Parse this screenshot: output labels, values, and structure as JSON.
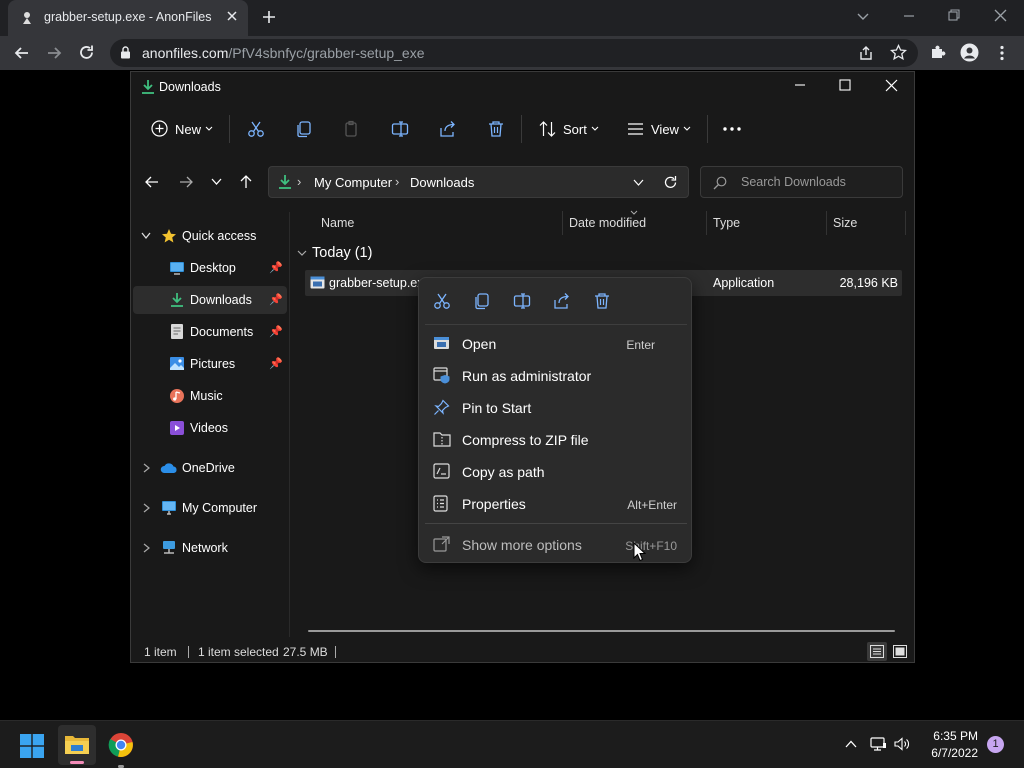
{
  "browser": {
    "tab_title": "grabber-setup.exe - AnonFiles",
    "url_host": "anonfiles.com",
    "url_path": "/PfV4sbnfyc/grabber-setup_exe"
  },
  "explorer": {
    "window_title": "Downloads",
    "toolbar": {
      "new_label": "New",
      "sort_label": "Sort",
      "view_label": "View",
      "more_label": "..."
    },
    "breadcrumb": [
      "My Computer",
      "Downloads"
    ],
    "search_placeholder": "Search Downloads",
    "nav": {
      "quick_access": "Quick access",
      "items": [
        {
          "label": "Desktop",
          "icon": "desktop-icon",
          "pinned": true
        },
        {
          "label": "Downloads",
          "icon": "downloads-icon",
          "pinned": true,
          "selected": true
        },
        {
          "label": "Documents",
          "icon": "documents-icon",
          "pinned": true
        },
        {
          "label": "Pictures",
          "icon": "pictures-icon",
          "pinned": true
        },
        {
          "label": "Music",
          "icon": "music-icon",
          "pinned": false
        },
        {
          "label": "Videos",
          "icon": "videos-icon",
          "pinned": false
        }
      ],
      "onedrive": "OneDrive",
      "my_computer": "My Computer",
      "network": "Network"
    },
    "columns": [
      "Name",
      "Date modified",
      "Type",
      "Size"
    ],
    "group_label": "Today (1)",
    "file": {
      "name": "grabber-setup.exe",
      "type": "Application",
      "size": "28,196 KB"
    },
    "status": {
      "items": "1 item",
      "selected": "1 item selected",
      "size": "27.5 MB"
    }
  },
  "context_menu": {
    "items": [
      {
        "label": "Open",
        "shortcut": "Enter",
        "icon": "open-icon"
      },
      {
        "label": "Run as administrator",
        "shortcut": "",
        "icon": "run-as-admin-icon"
      },
      {
        "label": "Pin to Start",
        "shortcut": "",
        "icon": "pin-icon"
      },
      {
        "label": "Compress to ZIP file",
        "shortcut": "",
        "icon": "zip-icon"
      },
      {
        "label": "Copy as path",
        "shortcut": "",
        "icon": "copy-path-icon"
      },
      {
        "label": "Properties",
        "shortcut": "Alt+Enter",
        "icon": "properties-icon"
      }
    ],
    "more": {
      "label": "Show more options",
      "shortcut": "Shift+F10"
    }
  },
  "taskbar": {
    "time": "6:35 PM",
    "date": "6/7/2022",
    "notification_count": "1"
  },
  "colors": {
    "accent_download": "#3fbf7f",
    "folder_yellow": "#e8b838",
    "selection": "#2d2d2d"
  }
}
